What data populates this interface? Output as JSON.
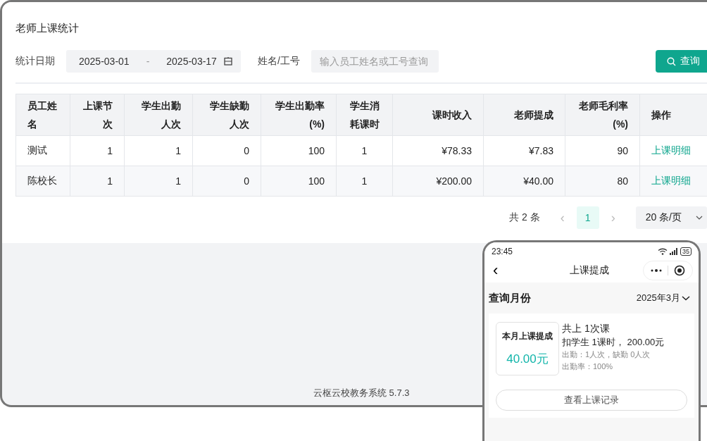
{
  "page_title": "老师上课统计",
  "filters": {
    "date_label": "统计日期",
    "date_start": "2025-03-01",
    "date_separator": "-",
    "date_end": "2025-03-17",
    "name_label": "姓名/工号",
    "name_placeholder": "输入员工姓名或工号查询",
    "query_button": "查询"
  },
  "table": {
    "columns": [
      {
        "label": "员工姓名"
      },
      {
        "label": "上课节次"
      },
      {
        "label": "学生出勤人次"
      },
      {
        "label": "学生缺勤人次"
      },
      {
        "label": "学生出勤率(%)"
      },
      {
        "label": "学生消耗课时"
      },
      {
        "label": "课时收入"
      },
      {
        "label": "老师提成"
      },
      {
        "label": "老师毛利率(%)"
      },
      {
        "label": "操作"
      }
    ],
    "rows": [
      {
        "cells": [
          "测试",
          "1",
          "1",
          "0",
          "100",
          "1",
          "¥78.33",
          "¥7.83",
          "90"
        ],
        "action": "上课明细"
      },
      {
        "cells": [
          "陈校长",
          "1",
          "1",
          "0",
          "100",
          "1",
          "¥200.00",
          "¥40.00",
          "80"
        ],
        "action": "上课明细"
      }
    ]
  },
  "pagination": {
    "total": "共 2 条",
    "prev": "‹",
    "pages": [
      {
        "label": "1",
        "selected": true
      }
    ],
    "next": "›",
    "page_size": "20 条/页"
  },
  "footer": "云枢云校教务系统 5.7.3",
  "phone": {
    "time": "23:45",
    "battery": "35",
    "title": "上课提成",
    "back": "‹",
    "month_label": "查询月份",
    "month_value": "2025年3月",
    "card": {
      "label": "本月上课提成",
      "amount": "40.00元",
      "lines": [
        {
          "text": "共上 1次课",
          "kind": "main"
        },
        {
          "text": "扣学生 1课时， 200.00元",
          "kind": "main"
        },
        {
          "text": "出勤：1人次，缺勤 0人次",
          "kind": "sub"
        },
        {
          "text": "出勤率：100%",
          "kind": "sub"
        }
      ]
    },
    "records_button": "查看上课记录"
  }
}
